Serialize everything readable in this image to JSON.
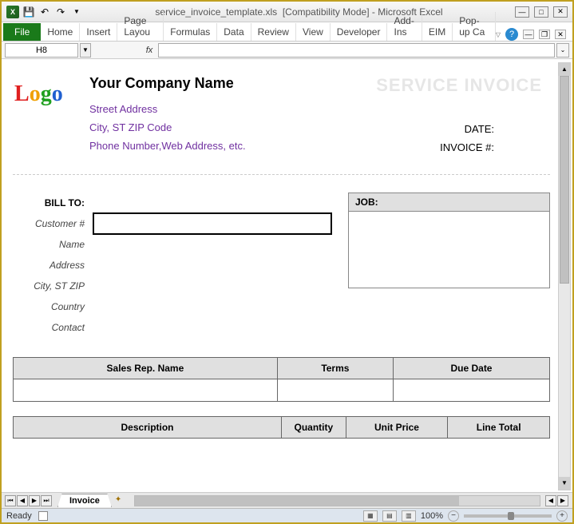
{
  "titlebar": {
    "filename": "service_invoice_template.xls",
    "mode": "[Compatibility Mode]",
    "app": "Microsoft Excel"
  },
  "ribbon": {
    "file": "File",
    "tabs": [
      "Home",
      "Insert",
      "Page Layou",
      "Formulas",
      "Data",
      "Review",
      "View",
      "Developer",
      "Add-Ins",
      "EIM",
      "Pop-up Ca"
    ]
  },
  "namebox": {
    "cell": "H8"
  },
  "formula": {
    "fx": "fx"
  },
  "invoice": {
    "logo_text": "Logo",
    "company_name": "Your Company Name",
    "street": "Street Address",
    "city_line": "City, ST  ZIP Code",
    "contact_line": "Phone Number,Web Address, etc.",
    "title": "SERVICE INVOICE",
    "date_label": "DATE:",
    "invoice_no_label": "INVOICE #:",
    "bill_to": "BILL TO:",
    "customer_no": "Customer #",
    "name": "Name",
    "address": "Address",
    "city_st_zip": "City, ST ZIP",
    "country": "Country",
    "contact": "Contact",
    "job": "JOB:",
    "sales_rep": "Sales Rep. Name",
    "terms": "Terms",
    "due_date": "Due Date",
    "description": "Description",
    "quantity": "Quantity",
    "unit_price": "Unit Price",
    "line_total": "Line Total"
  },
  "sheet": {
    "tab": "Invoice"
  },
  "status": {
    "ready": "Ready",
    "zoom": "100%"
  }
}
